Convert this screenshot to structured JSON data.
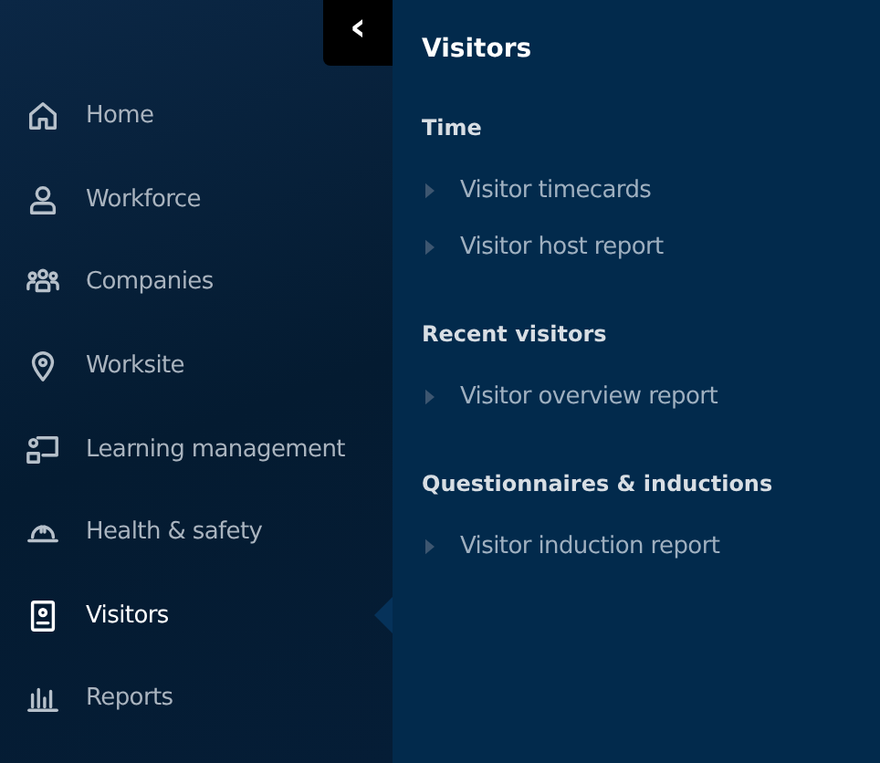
{
  "sidebar": {
    "collapse_button": {
      "label": "‹"
    },
    "items": [
      {
        "label": "Home",
        "selected": false
      },
      {
        "label": "Workforce",
        "selected": false
      },
      {
        "label": "Companies",
        "selected": false
      },
      {
        "label": "Worksite",
        "selected": false
      },
      {
        "label": "Learning management",
        "selected": false
      },
      {
        "label": "Health & safety",
        "selected": false
      },
      {
        "label": "Visitors",
        "selected": true
      },
      {
        "label": "Reports",
        "selected": false
      }
    ]
  },
  "submenu": {
    "title": "Visitors",
    "sections": [
      {
        "heading": "Time",
        "links": [
          "Visitor timecards",
          "Visitor host report"
        ]
      },
      {
        "heading": "Recent visitors",
        "links": [
          "Visitor overview report"
        ]
      },
      {
        "heading": "Questionnaires & inductions",
        "links": [
          "Visitor induction report"
        ]
      }
    ]
  }
}
